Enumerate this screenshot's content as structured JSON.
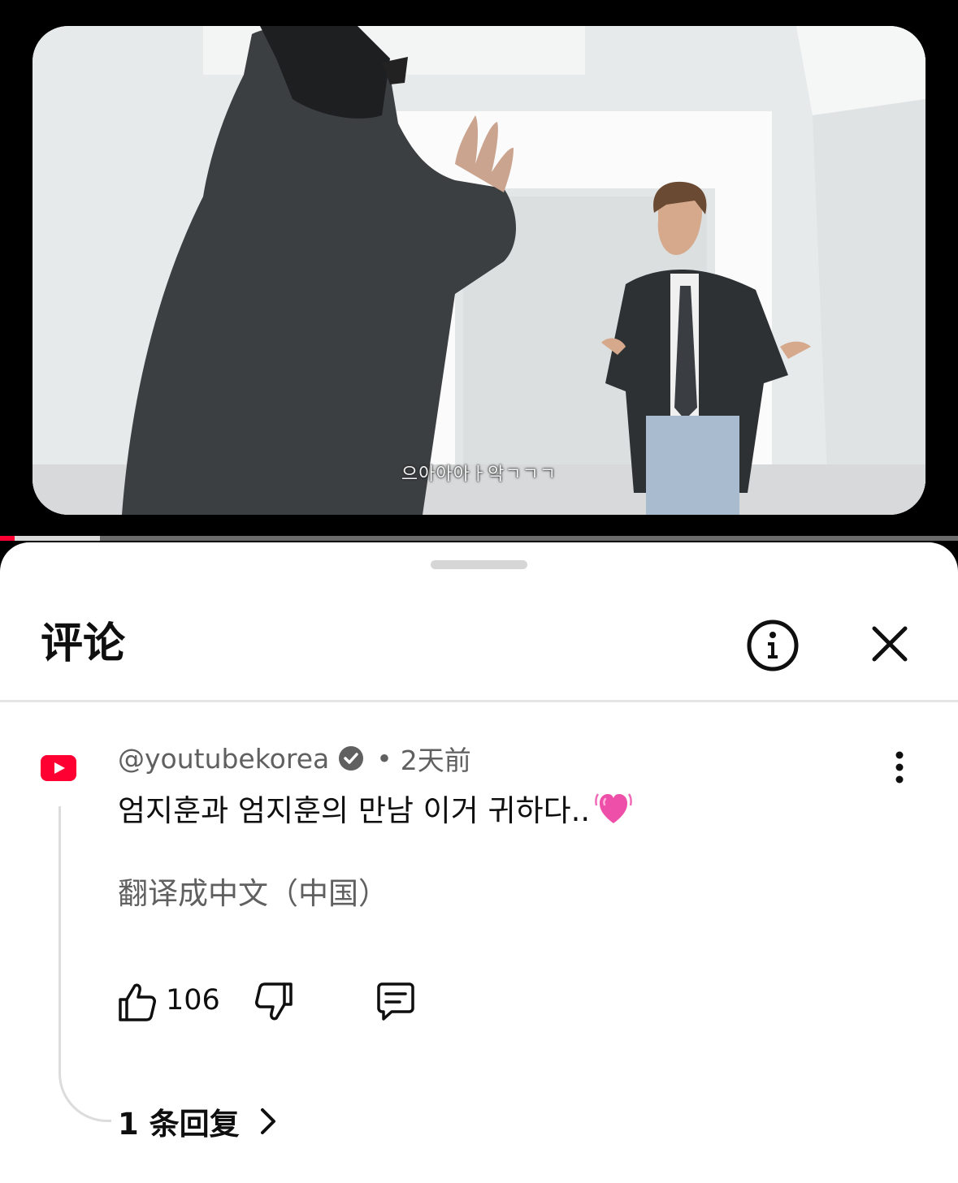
{
  "video": {
    "subtitle": "으아아아ㅏ악ㄱㄱㄱ",
    "progress_played_fraction": 0.015,
    "progress_buffered_fraction": 0.104
  },
  "comments_panel": {
    "title": "评论",
    "info_icon": "info-circle-icon",
    "close_icon": "close-x-icon"
  },
  "comment": {
    "avatar_icon": "youtube-logo-icon",
    "author": "@youtubekorea",
    "verified_icon": "verified-check-icon",
    "separator": "•",
    "time": "2天前",
    "text": "엄지훈과 엄지훈의 만남 이거 귀하다..",
    "emoji": "💓",
    "translate_label": "翻译成中文（中国）",
    "like_count": "106",
    "replies_label": "1 条回复",
    "more_icon": "more-vertical-icon"
  },
  "colors": {
    "accent": "#ff0033",
    "text_primary": "#0f0f0f",
    "text_secondary": "#606060"
  }
}
